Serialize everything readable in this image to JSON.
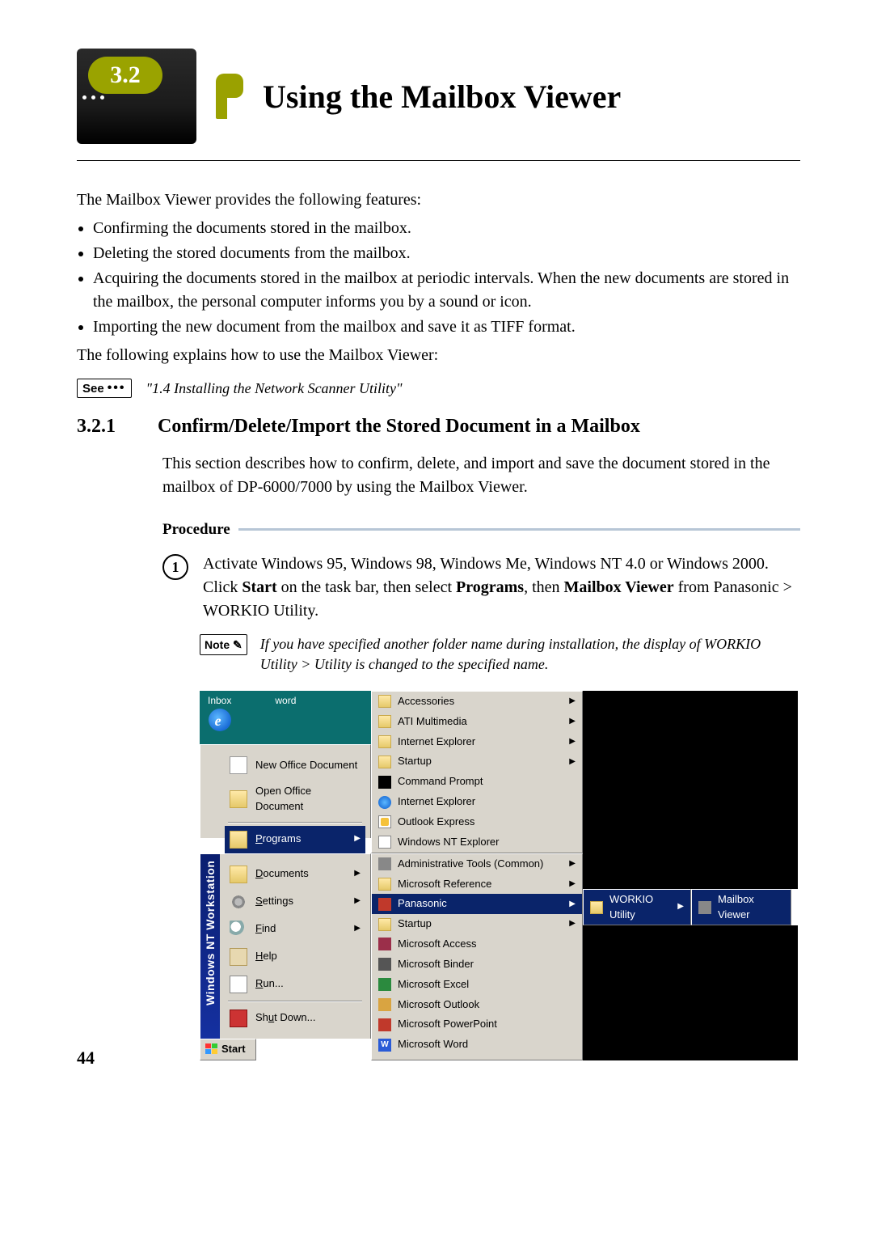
{
  "section_number": "3.2",
  "title": "Using the Mailbox Viewer",
  "intro": "The Mailbox Viewer provides the following features:",
  "features": [
    "Confirming the documents stored in the mailbox.",
    "Deleting the stored documents from the mailbox.",
    "Acquiring the documents stored in the mailbox at periodic intervals. When the new documents are stored in the mailbox, the personal computer informs you by a sound or icon.",
    "Importing the new document from the mailbox and save it as TIFF format."
  ],
  "following_line": "The following explains how to use the Mailbox Viewer:",
  "see_label": "See",
  "see_ref": "\"1.4  Installing the Network Scanner Utility\"",
  "subsection_num": "3.2.1",
  "subsection_title": "Confirm/Delete/Import the Stored Document in a Mailbox",
  "subsection_intro": "This section describes how to confirm, delete, and import and save the document stored in the mailbox of DP-6000/7000 by using the Mailbox Viewer.",
  "procedure_label": "Procedure",
  "step1_num": "1",
  "step1_a": "Activate Windows 95, Windows 98, Windows Me, Windows NT 4.0 or Windows 2000. Click ",
  "step1_b": "Start",
  "step1_c": " on the task bar, then select ",
  "step1_d": "Programs",
  "step1_e": ", then ",
  "step1_f": "Mailbox Viewer",
  "step1_g": " from Panasonic > WORKIO Utility.",
  "note_label": "Note",
  "note_text": "If you have specified another folder name during installation, the display of WORKIO Utility > Utility is changed to the specified name.",
  "startmenu": {
    "desktop_icons": {
      "inbox": "Inbox",
      "word": "word"
    },
    "stripe": "Windows NT Workstation",
    "left_items_top": [
      {
        "label": "New Office Document"
      },
      {
        "label": "Open Office Document"
      }
    ],
    "left_items_mid": [
      {
        "label_pre": "P",
        "label": "rograms",
        "arrow": true,
        "hl": true
      },
      {
        "label_pre": "D",
        "label": "ocuments",
        "arrow": true
      },
      {
        "label_pre": "S",
        "label": "ettings",
        "arrow": true
      },
      {
        "label_pre": "F",
        "label": "ind",
        "arrow": true
      },
      {
        "label_pre": "H",
        "label": "elp"
      },
      {
        "label_pre": "R",
        "label": "un..."
      }
    ],
    "left_items_bot": [
      {
        "label_pre": "",
        "label": "Shut Down...",
        "u_index": 3
      }
    ],
    "start_label": "Start",
    "col2_upper": [
      {
        "label": "Accessories",
        "arrow": true,
        "icon": "pf"
      },
      {
        "label": "ATI Multimedia",
        "arrow": true,
        "icon": "pf"
      },
      {
        "label": "Internet Explorer",
        "arrow": true,
        "icon": "pf"
      },
      {
        "label": "Startup",
        "arrow": true,
        "icon": "pf"
      },
      {
        "label": "Command Prompt",
        "icon": "cmd"
      },
      {
        "label": "Internet Explorer",
        "icon": "ie"
      },
      {
        "label": "Outlook Express",
        "icon": "ox"
      },
      {
        "label": "Windows NT Explorer",
        "icon": "we"
      }
    ],
    "col2_lower": [
      {
        "label": "Administrative Tools (Common)",
        "arrow": true,
        "icon": "tools"
      },
      {
        "label": "Microsoft Reference",
        "arrow": true,
        "icon": "pf"
      },
      {
        "label": "Panasonic",
        "arrow": true,
        "hl": true,
        "icon": "pana"
      },
      {
        "label": "Startup",
        "arrow": true,
        "icon": "pf"
      },
      {
        "label": "Microsoft Access",
        "icon": "access"
      },
      {
        "label": "Microsoft Binder",
        "icon": "binder"
      },
      {
        "label": "Microsoft Excel",
        "icon": "excel"
      },
      {
        "label": "Microsoft Outlook",
        "icon": "outlook"
      },
      {
        "label": "Microsoft PowerPoint",
        "icon": "pp"
      },
      {
        "label": "Microsoft Word",
        "icon": "word"
      }
    ],
    "col3": [
      {
        "label": "WORKIO Utility",
        "arrow": true,
        "hl": true,
        "icon": "pf"
      }
    ],
    "col4": [
      {
        "label": "Mailbox Viewer",
        "hl": true,
        "icon": "mv"
      }
    ]
  },
  "page_number": "44"
}
